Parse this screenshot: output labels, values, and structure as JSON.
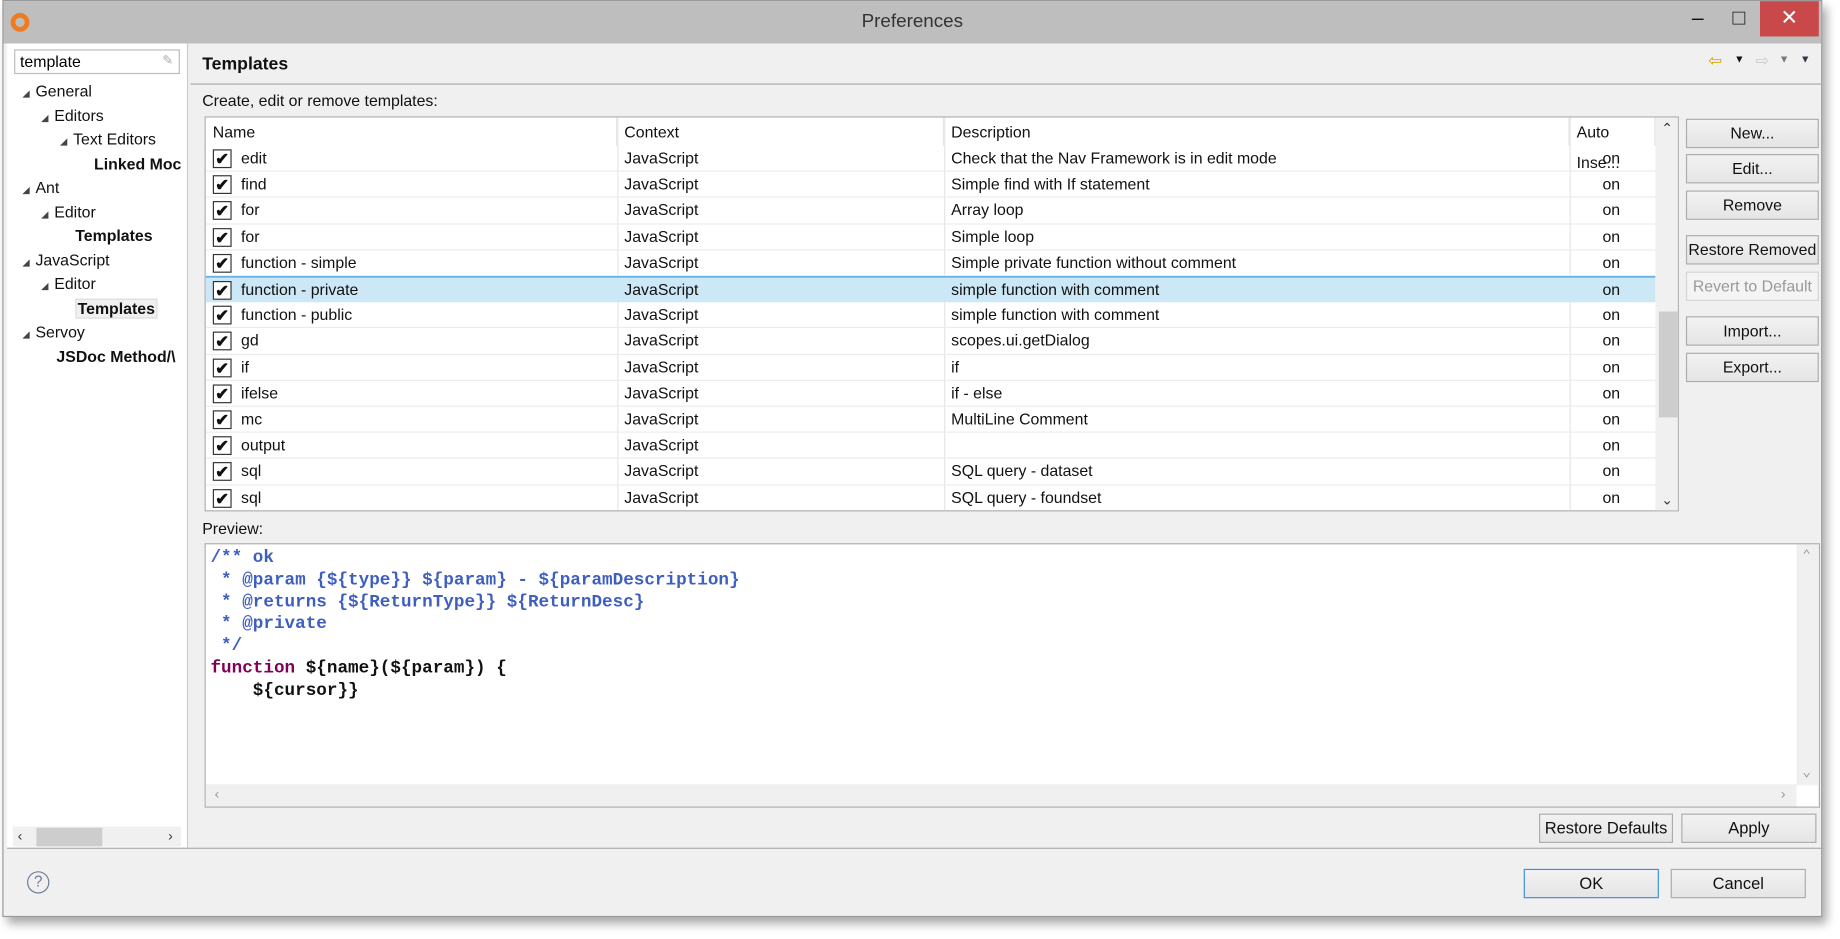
{
  "window": {
    "title": "Preferences",
    "minimize_icon": "minimize-icon",
    "maximize_icon": "maximize-icon",
    "close_icon": "close-icon",
    "close_color": "#c9494a"
  },
  "sidebar": {
    "filter_value": "template",
    "tree": [
      {
        "label": "General",
        "level": 0,
        "expanded": true
      },
      {
        "label": "Editors",
        "level": 1,
        "expanded": true
      },
      {
        "label": "Text Editors",
        "level": 2,
        "expanded": true
      },
      {
        "label": "Linked Moc",
        "level": 3,
        "bold": true
      },
      {
        "label": "Ant",
        "level": 0,
        "expanded": true
      },
      {
        "label": "Editor",
        "level": 1,
        "expanded": true
      },
      {
        "label": "Templates",
        "level": 2,
        "bold": true
      },
      {
        "label": "JavaScript",
        "level": 0,
        "expanded": true
      },
      {
        "label": "Editor",
        "level": 1,
        "expanded": true
      },
      {
        "label": "Templates",
        "level": 2,
        "bold": true,
        "selected": true
      },
      {
        "label": "Servoy",
        "level": 0,
        "expanded": true
      },
      {
        "label": "JSDoc Method/\\",
        "level": 1,
        "bold": true
      }
    ]
  },
  "page": {
    "title": "Templates",
    "description": "Create, edit or remove templates:",
    "table": {
      "columns": [
        "Name",
        "Context",
        "Description",
        "Auto Inse..."
      ],
      "rows": [
        {
          "checked": true,
          "name": "edit",
          "context": "JavaScript",
          "description": "Check that the Nav Framework is in edit mode",
          "auto": "on"
        },
        {
          "checked": true,
          "name": "find",
          "context": "JavaScript",
          "description": "Simple find with If statement",
          "auto": "on"
        },
        {
          "checked": true,
          "name": "for",
          "context": "JavaScript",
          "description": "Array loop",
          "auto": "on"
        },
        {
          "checked": true,
          "name": "for",
          "context": "JavaScript",
          "description": "Simple loop",
          "auto": "on"
        },
        {
          "checked": true,
          "name": "function -  simple",
          "context": "JavaScript",
          "description": "Simple private function without comment",
          "auto": "on"
        },
        {
          "checked": true,
          "name": "function - private",
          "context": "JavaScript",
          "description": "simple function with comment",
          "auto": "on",
          "selected": true
        },
        {
          "checked": true,
          "name": "function - public",
          "context": "JavaScript",
          "description": "simple function with comment",
          "auto": "on"
        },
        {
          "checked": true,
          "name": "gd",
          "context": "JavaScript",
          "description": "scopes.ui.getDialog",
          "auto": "on"
        },
        {
          "checked": true,
          "name": "if",
          "context": "JavaScript",
          "description": "if",
          "auto": "on"
        },
        {
          "checked": true,
          "name": "ifelse",
          "context": "JavaScript",
          "description": "if - else",
          "auto": "on"
        },
        {
          "checked": true,
          "name": "mc",
          "context": "JavaScript",
          "description": "MultiLine Comment",
          "auto": "on"
        },
        {
          "checked": true,
          "name": "output",
          "context": "JavaScript",
          "description": "",
          "auto": "on"
        },
        {
          "checked": true,
          "name": "sql",
          "context": "JavaScript",
          "description": "SQL query - dataset",
          "auto": "on"
        },
        {
          "checked": true,
          "name": "sql",
          "context": "JavaScript",
          "description": "SQL query - foundset",
          "auto": "on"
        }
      ]
    },
    "buttons": {
      "new": "New...",
      "edit": "Edit...",
      "remove": "Remove",
      "restore_removed": "Restore Removed",
      "revert": "Revert to Default",
      "import": "Import...",
      "export": "Export..."
    },
    "preview_label": "Preview:",
    "preview_lines": [
      {
        "text": "/** ok",
        "style": "comment"
      },
      {
        "text": " * @param {${type}} ${param} - ${paramDescription}",
        "style": "comment"
      },
      {
        "text": " * @returns {${ReturnType}} ${ReturnDesc}",
        "style": "comment"
      },
      {
        "text": " * @private",
        "style": "comment"
      },
      {
        "text": " */",
        "style": "comment"
      },
      {
        "keyword": "function",
        "text": " ${name}(${param}) {",
        "style": "code"
      },
      {
        "text": "    ${cursor}}",
        "style": "code"
      }
    ],
    "restore_defaults": "Restore Defaults",
    "apply": "Apply"
  },
  "footer": {
    "ok": "OK",
    "cancel": "Cancel",
    "help_icon": "help-icon"
  },
  "colors": {
    "selection": "#cce8f6",
    "comment": "#3f5fbf",
    "keyword": "#7f0055",
    "ok_border": "#3c8fe0"
  }
}
